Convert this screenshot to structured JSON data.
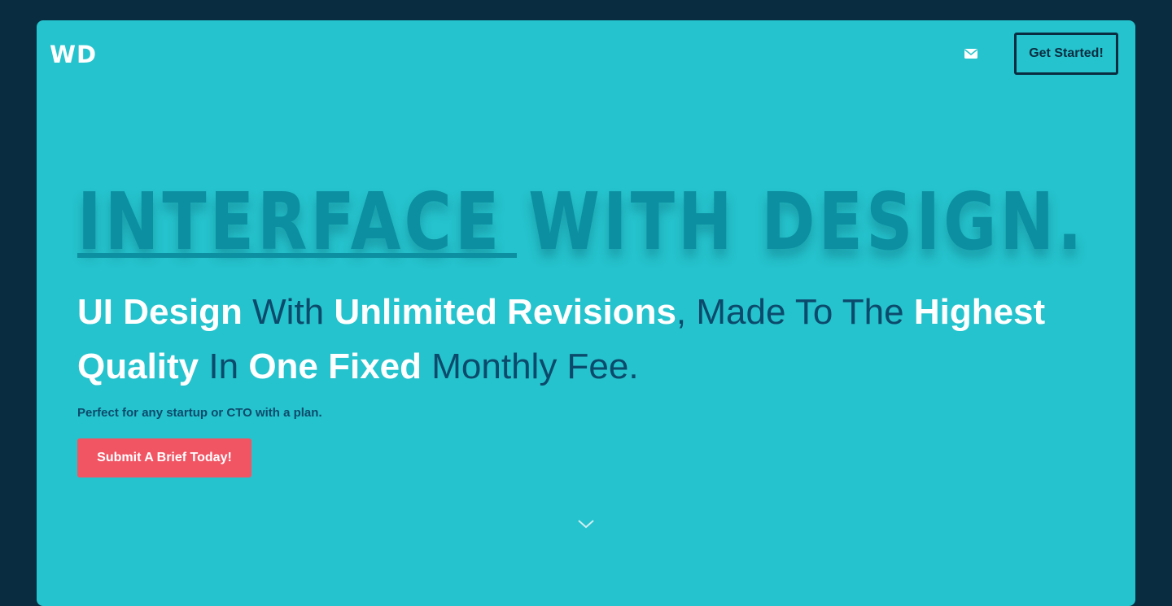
{
  "header": {
    "logo_text": "WD",
    "mail_icon": "envelope-icon",
    "cta_label": "Get Started!"
  },
  "hero": {
    "headline": "INTERFACE WITH DESIGN.",
    "subheadline": {
      "part1": "UI Design",
      "part2": " With ",
      "part3": "Unlimited Revisions",
      "part4": ", Made To The ",
      "part5": "Highest Quality",
      "part6": " In ",
      "part7": "One Fixed",
      "part8": " Monthly Fee."
    },
    "tagline": "Perfect for any startup or CTO with a plan.",
    "submit_label": "Submit A Brief Today!",
    "scroll_icon": "chevron-down-icon"
  },
  "colors": {
    "page_background": "#0a2c40",
    "card_background": "#25c3cd",
    "headline": "#0b8fa1",
    "dark_text": "#0c4a6c",
    "accent_button": "#f15564",
    "white": "#ffffff"
  }
}
